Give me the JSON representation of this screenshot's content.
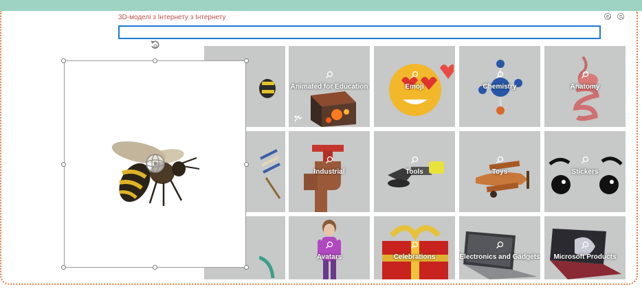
{
  "dialog": {
    "title": "3D-моделі з Інтернету з Інтернету",
    "search_value": "",
    "happy_feedback_icon": "smiley-happy-icon",
    "sad_feedback_icon": "smiley-sad-icon"
  },
  "colors": {
    "accent_blue": "#1a79d4",
    "title_red": "#c0504d",
    "frame_orange": "#e2783c",
    "top_band": "#9ed3c4",
    "tile_gray": "#c7c8c8"
  },
  "categories": [
    {
      "label": ""
    },
    {
      "label": "Animated for Education"
    },
    {
      "label": "Emoji"
    },
    {
      "label": "Chemistry"
    },
    {
      "label": "Anatomy"
    },
    {
      "label": ""
    },
    {
      "label": "Industrial"
    },
    {
      "label": "Tools"
    },
    {
      "label": "Toys"
    },
    {
      "label": "Stickers"
    },
    {
      "label": ""
    },
    {
      "label": "Avatars"
    },
    {
      "label": "Celebrations"
    },
    {
      "label": "Electronics and Gadgets"
    },
    {
      "label": "Microsoft Products"
    }
  ],
  "selected_model": {
    "icon": "bee-3d-model",
    "rotate_icon": "rotate-handle-icon",
    "orbit_icon": "3d-orbit-control-icon"
  }
}
